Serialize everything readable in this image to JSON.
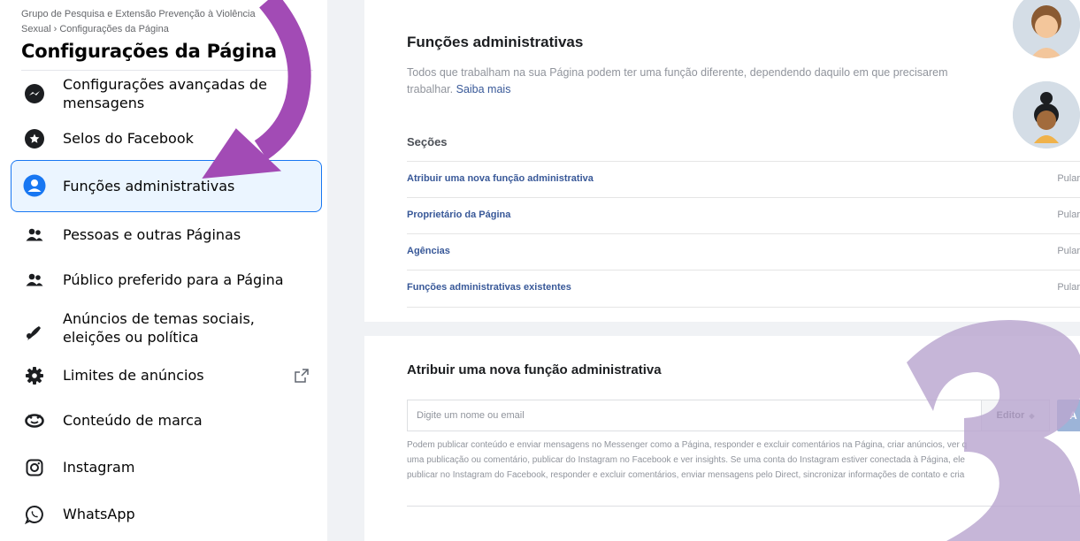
{
  "sidebar": {
    "breadcrumb": {
      "parent": "Grupo de Pesquisa e Extensão Prevenção à Violência Sexual",
      "current": "Configurações da Página"
    },
    "title": "Configurações da Página",
    "items": [
      {
        "label": "Configurações avançadas de mensagens",
        "icon": "messenger-icon"
      },
      {
        "label": "Selos do Facebook",
        "icon": "badge-icon"
      },
      {
        "label": "Funções administrativas",
        "icon": "person-icon",
        "active": true
      },
      {
        "label": "Pessoas e outras Páginas",
        "icon": "people-icon"
      },
      {
        "label": "Público preferido para a Página",
        "icon": "people-icon"
      },
      {
        "label": "Anúncios de temas sociais, eleições ou política",
        "icon": "megaphone-icon"
      },
      {
        "label": "Limites de anúncios",
        "icon": "gear-icon",
        "external": true
      },
      {
        "label": "Conteúdo de marca",
        "icon": "handshake-icon"
      },
      {
        "label": "Instagram",
        "icon": "instagram-icon"
      },
      {
        "label": "WhatsApp",
        "icon": "whatsapp-icon"
      }
    ]
  },
  "main": {
    "heading": "Funções administrativas",
    "intro": "Todos que trabalham na sua Página podem ter uma função diferente, dependendo daquilo em que precisarem trabalhar.",
    "intro_link": "Saiba mais",
    "sections_title": "Seções",
    "sections": [
      {
        "label": "Atribuir uma nova função administrativa",
        "action": "Pular"
      },
      {
        "label": "Proprietário da Página",
        "action": "Pular"
      },
      {
        "label": "Agências",
        "action": "Pular"
      },
      {
        "label": "Funções administrativas existentes",
        "action": "Pular"
      }
    ],
    "assign": {
      "title": "Atribuir uma nova função administrativa",
      "input_placeholder": "Digite um nome ou email",
      "role": "Editor",
      "button": "A",
      "description_lines": [
        "Podem publicar conteúdo e enviar mensagens no Messenger como a Página, responder e excluir comentários na Página, criar anúncios, ver q",
        "uma publicação ou comentário, publicar do Instagram no Facebook e ver insights. Se uma conta do Instagram estiver conectada à Página, ele",
        "publicar no Instagram do Facebook, responder e excluir comentários, enviar mensagens pelo Direct, sincronizar informações de contato e cria"
      ]
    }
  },
  "colors": {
    "accent": "#1877f2",
    "active_bg": "#ebf5ff",
    "link": "#385898",
    "arrow": "#a24bb5",
    "numeral": "#b9a6d0"
  }
}
